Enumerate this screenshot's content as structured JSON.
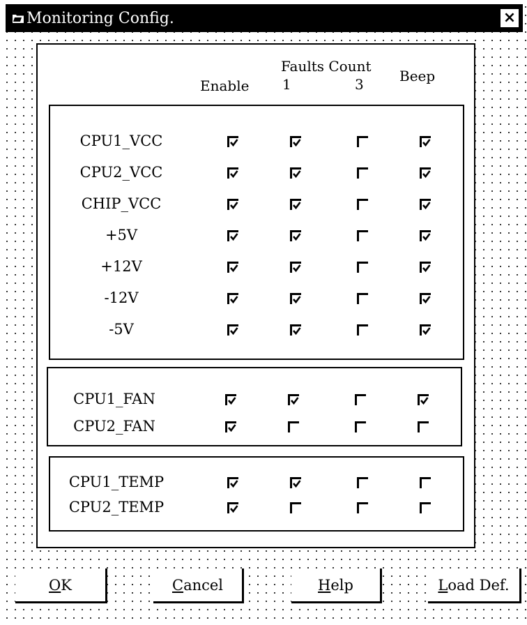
{
  "window": {
    "title": "Monitoring Config.",
    "close_label": "×"
  },
  "headers": {
    "enable": "Enable",
    "faults_count": "Faults Count",
    "faults_1": "1",
    "faults_3": "3",
    "beep": "Beep"
  },
  "voltage_rows": [
    {
      "label": "CPU1_VCC",
      "enable": true,
      "faults_1": true,
      "faults_3": false,
      "beep": true
    },
    {
      "label": "CPU2_VCC",
      "enable": true,
      "faults_1": true,
      "faults_3": false,
      "beep": true
    },
    {
      "label": "CHIP_VCC",
      "enable": true,
      "faults_1": true,
      "faults_3": false,
      "beep": true
    },
    {
      "label": "+5V",
      "enable": true,
      "faults_1": true,
      "faults_3": false,
      "beep": true
    },
    {
      "label": "+12V",
      "enable": true,
      "faults_1": true,
      "faults_3": false,
      "beep": true
    },
    {
      "label": "-12V",
      "enable": true,
      "faults_1": true,
      "faults_3": false,
      "beep": true
    },
    {
      "label": "-5V",
      "enable": true,
      "faults_1": true,
      "faults_3": false,
      "beep": true
    }
  ],
  "fan_rows": [
    {
      "label": "CPU1_FAN",
      "enable": true,
      "faults_1": true,
      "faults_3": false,
      "beep": true
    },
    {
      "label": "CPU2_FAN",
      "enable": true,
      "faults_1": false,
      "faults_3": false,
      "beep": false
    }
  ],
  "temp_rows": [
    {
      "label": "CPU1_TEMP",
      "enable": true,
      "faults_1": true,
      "faults_3": false,
      "beep": false
    },
    {
      "label": "CPU2_TEMP",
      "enable": true,
      "faults_1": false,
      "faults_3": false,
      "beep": false
    }
  ],
  "buttons": {
    "ok": {
      "hotkey": "O",
      "rest": "K"
    },
    "cancel": {
      "hotkey": "C",
      "rest": "ancel"
    },
    "help": {
      "hotkey": "H",
      "rest": "elp"
    },
    "load_def": {
      "hotkey": "L",
      "rest": "oad Def."
    }
  }
}
